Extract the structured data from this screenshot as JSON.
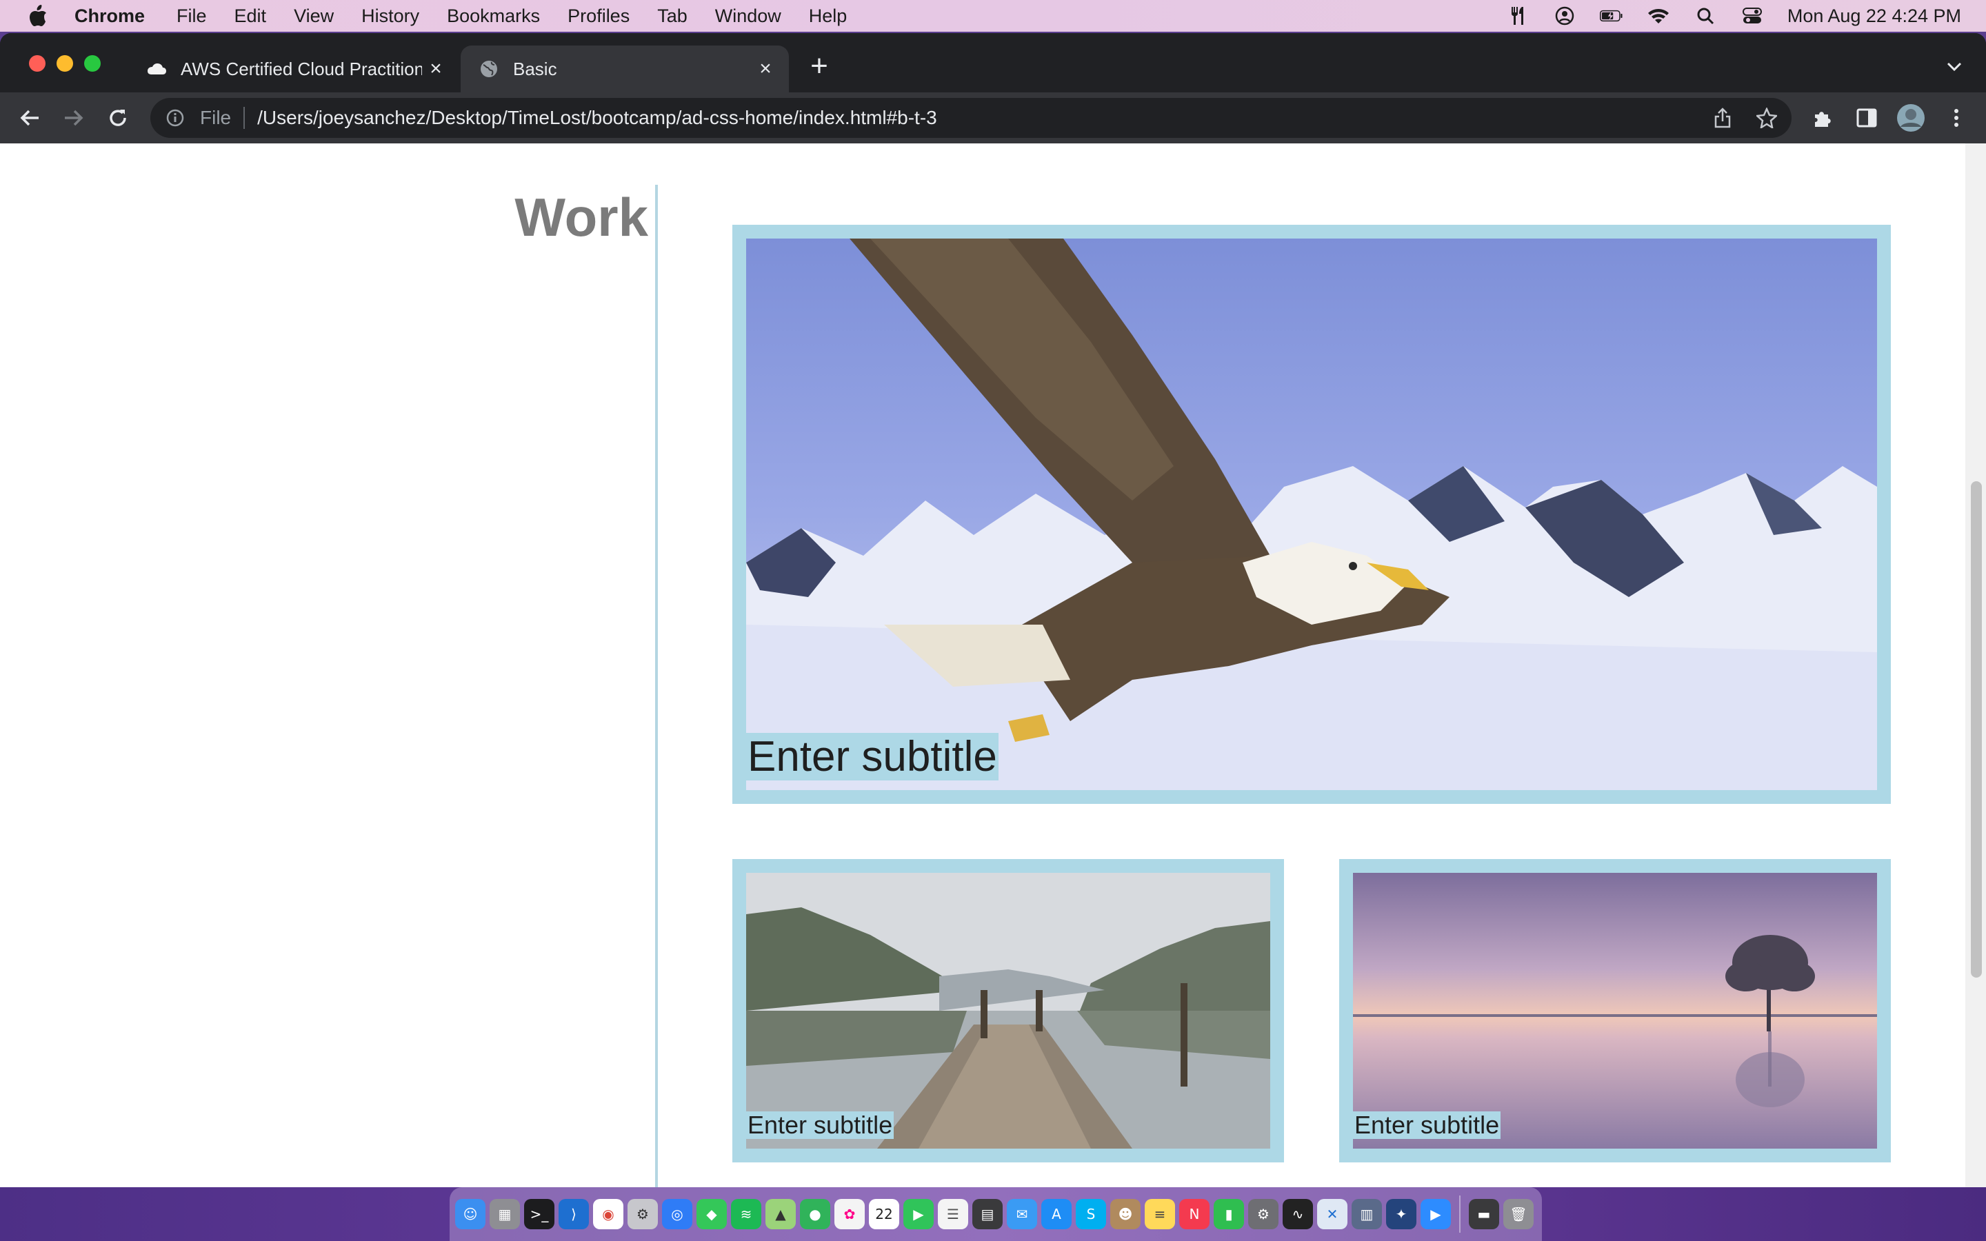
{
  "menubar": {
    "app_name": "Chrome",
    "items": [
      "File",
      "Edit",
      "View",
      "History",
      "Bookmarks",
      "Profiles",
      "Tab",
      "Window",
      "Help"
    ],
    "clock": "Mon Aug 22  4:24 PM"
  },
  "browser": {
    "tabs": [
      {
        "title": "AWS Certified Cloud Practitioner",
        "icon": "cloud-icon",
        "active": false
      },
      {
        "title": "Basic",
        "icon": "globe-icon",
        "active": true
      }
    ],
    "address": {
      "scheme_label": "File",
      "url": "/Users/joeysanchez/Desktop/TimeLost/bootcamp/ad-css-home/index.html#b-t-3"
    }
  },
  "page": {
    "section_title": "Work",
    "cards": [
      {
        "subtitle": "Enter subtitle",
        "image": "eagle-over-snowy-mountains"
      },
      {
        "subtitle": "Enter subtitle",
        "image": "lake-pier-mountains"
      },
      {
        "subtitle": "Enter subtitle",
        "image": "sunset-lake-tree"
      }
    ]
  },
  "colors": {
    "card_frame": "#add8e6",
    "title_gray": "#7b7b7b",
    "divider": "#b4d6e2"
  },
  "dock": {
    "icons": [
      "finder-icon",
      "launchpad-icon",
      "terminal-icon",
      "vscode-icon",
      "chrome-icon",
      "settings-icon",
      "safari-icon",
      "messages-icon",
      "spotify-icon",
      "maps-icon",
      "find-my-icon",
      "photos-icon",
      "calendar-icon",
      "facetime-icon",
      "reminders-icon",
      "calculator-icon",
      "mail-icon",
      "app-store-icon",
      "skype-icon",
      "contacts-icon",
      "notes-icon",
      "news-icon",
      "numbers-icon",
      "system-preferences-icon",
      "activity-monitor-icon",
      "xcode-icon",
      "rar-icon",
      "tableau-icon",
      "zoom-icon",
      "downloads-icon",
      "trash-icon"
    ],
    "calendar_day": "22"
  }
}
